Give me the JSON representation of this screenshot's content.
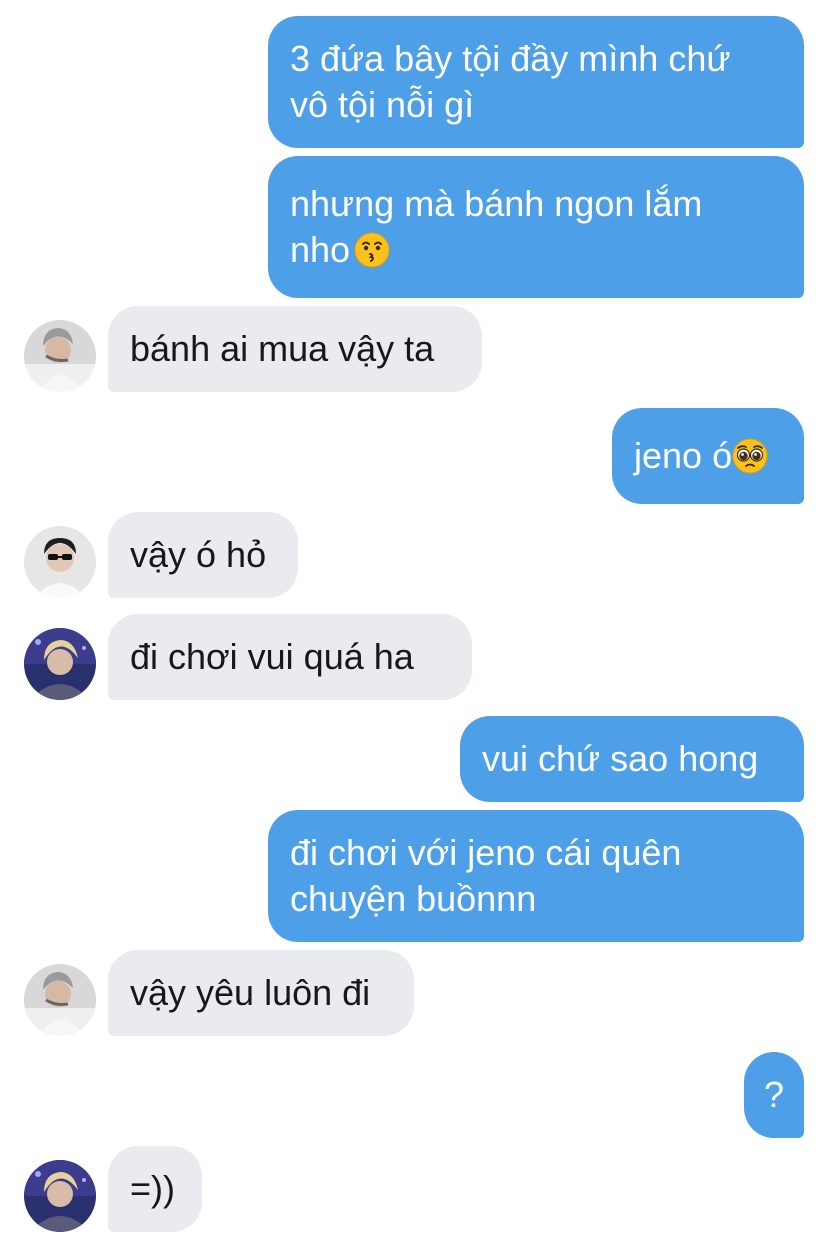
{
  "messages": {
    "m1": {
      "text": "3 đứa bây tội đầy mình chứ\nvô tội nỗi gì"
    },
    "m2": {
      "text": "nhưng mà bánh ngon lắm\nnho",
      "emoji": "kissing-face"
    },
    "m3": {
      "text": "bánh ai mua vậy ta"
    },
    "m4": {
      "text": "jeno ó",
      "emoji": "pleading-face"
    },
    "m5": {
      "text": "vậy ó hỏ"
    },
    "m6": {
      "text": "đi chơi vui quá ha"
    },
    "m7": {
      "text": "vui chứ sao hong"
    },
    "m8": {
      "text": "đi chơi với jeno cái quên\nchuyện buồnnn"
    },
    "m9": {
      "text": "vậy yêu luôn đi"
    },
    "m10": {
      "text": "?"
    },
    "m11": {
      "text": "=))"
    }
  },
  "colors": {
    "outgoing_bubble": "#4d9fe8",
    "incoming_bubble": "#e9ebef",
    "outgoing_text": "#ffffff",
    "incoming_text": "#15181c"
  }
}
